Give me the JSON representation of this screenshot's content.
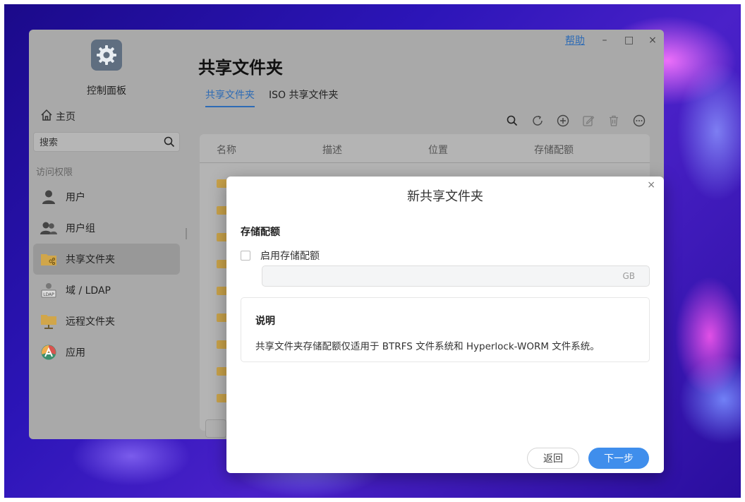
{
  "window": {
    "app_name": "控制面板",
    "controls": {
      "help": "帮助",
      "minimize": "–",
      "maximize": "□",
      "close": "×"
    }
  },
  "sidebar": {
    "home_label": "主页",
    "search_placeholder": "搜索",
    "section_label": "访问权限",
    "items": [
      {
        "label": "用户",
        "icon": "user-icon"
      },
      {
        "label": "用户组",
        "icon": "user-group-icon"
      },
      {
        "label": "共享文件夹",
        "icon": "shared-folder-icon",
        "active": true
      },
      {
        "label": "域 / LDAP",
        "icon": "ldap-icon"
      },
      {
        "label": "远程文件夹",
        "icon": "remote-folder-icon"
      },
      {
        "label": "应用",
        "icon": "app-icon"
      }
    ]
  },
  "main": {
    "title": "共享文件夹",
    "tabs": [
      {
        "label": "共享文件夹",
        "active": true
      },
      {
        "label": "ISO 共享文件夹",
        "active": false
      }
    ],
    "toolbar": [
      "search-icon",
      "refresh-icon",
      "add-icon",
      "edit-icon",
      "delete-icon",
      "more-icon"
    ],
    "table": {
      "columns": [
        "名称",
        "描述",
        "位置",
        "存储配额"
      ]
    }
  },
  "dialog": {
    "title": "新共享文件夹",
    "close": "×",
    "quota_heading": "存储配额",
    "enable_quota_label": "启用存储配额",
    "enable_quota_checked": false,
    "quota_value": "",
    "quota_unit": "GB",
    "note_title": "说明",
    "note_text": "共享文件夹存储配额仅适用于 BTRFS 文件系统和 Hyperlock-WORM 文件系统。",
    "back_button": "返回",
    "next_button": "下一步"
  },
  "colors": {
    "accent": "#3f8eec",
    "link": "#2d6bb5"
  }
}
